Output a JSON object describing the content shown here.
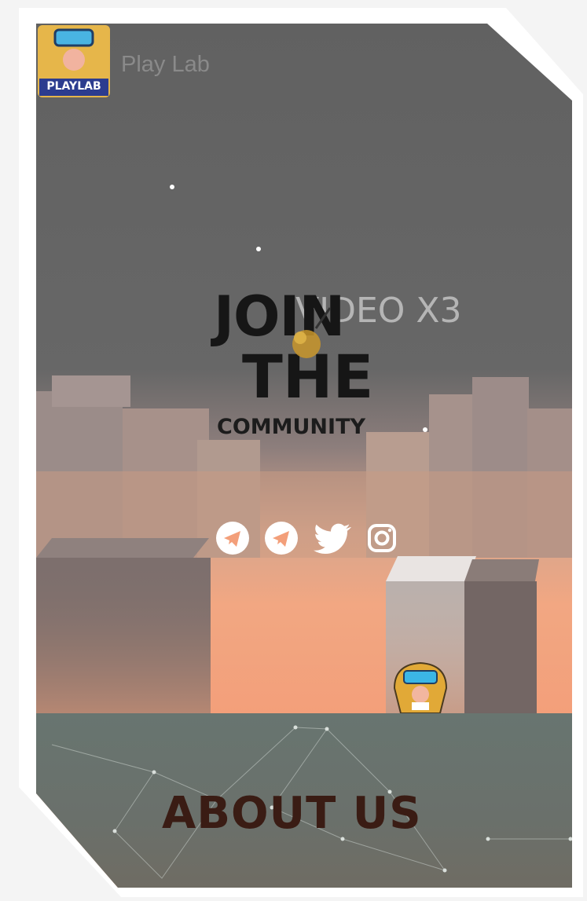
{
  "header": {
    "brand_name": "Play Lab",
    "logo_text": "PLAYLAB"
  },
  "hero": {
    "ghost_text": "VIDEO X3",
    "line1": "JOIN",
    "line2": "THE",
    "line3": "COMMUNITY"
  },
  "socials": [
    {
      "icon": "telegram-icon"
    },
    {
      "icon": "telegram-icon"
    },
    {
      "icon": "twitter-icon"
    },
    {
      "icon": "instagram-icon"
    }
  ],
  "section": {
    "about_label": "ABOUT US"
  },
  "colors": {
    "sky": "#616161",
    "sunset": "#f39f7a",
    "ground": "#687570",
    "title": "#161616",
    "about": "#3a1c14"
  }
}
